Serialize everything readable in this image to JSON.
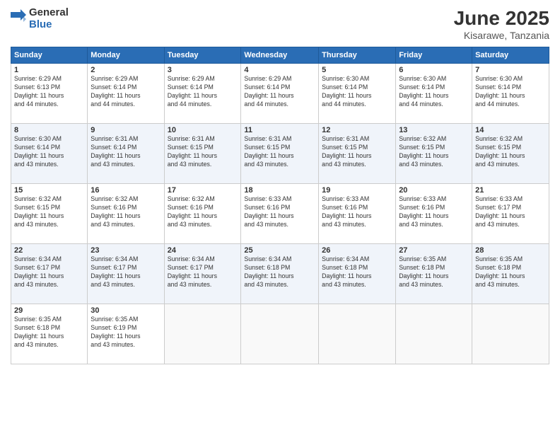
{
  "logo": {
    "general": "General",
    "blue": "Blue"
  },
  "title": {
    "month": "June 2025",
    "location": "Kisarawe, Tanzania"
  },
  "weekdays": [
    "Sunday",
    "Monday",
    "Tuesday",
    "Wednesday",
    "Thursday",
    "Friday",
    "Saturday"
  ],
  "weeks": [
    [
      {
        "day": "1",
        "info": "Sunrise: 6:29 AM\nSunset: 6:13 PM\nDaylight: 11 hours\nand 44 minutes."
      },
      {
        "day": "2",
        "info": "Sunrise: 6:29 AM\nSunset: 6:14 PM\nDaylight: 11 hours\nand 44 minutes."
      },
      {
        "day": "3",
        "info": "Sunrise: 6:29 AM\nSunset: 6:14 PM\nDaylight: 11 hours\nand 44 minutes."
      },
      {
        "day": "4",
        "info": "Sunrise: 6:29 AM\nSunset: 6:14 PM\nDaylight: 11 hours\nand 44 minutes."
      },
      {
        "day": "5",
        "info": "Sunrise: 6:30 AM\nSunset: 6:14 PM\nDaylight: 11 hours\nand 44 minutes."
      },
      {
        "day": "6",
        "info": "Sunrise: 6:30 AM\nSunset: 6:14 PM\nDaylight: 11 hours\nand 44 minutes."
      },
      {
        "day": "7",
        "info": "Sunrise: 6:30 AM\nSunset: 6:14 PM\nDaylight: 11 hours\nand 44 minutes."
      }
    ],
    [
      {
        "day": "8",
        "info": "Sunrise: 6:30 AM\nSunset: 6:14 PM\nDaylight: 11 hours\nand 43 minutes."
      },
      {
        "day": "9",
        "info": "Sunrise: 6:31 AM\nSunset: 6:14 PM\nDaylight: 11 hours\nand 43 minutes."
      },
      {
        "day": "10",
        "info": "Sunrise: 6:31 AM\nSunset: 6:15 PM\nDaylight: 11 hours\nand 43 minutes."
      },
      {
        "day": "11",
        "info": "Sunrise: 6:31 AM\nSunset: 6:15 PM\nDaylight: 11 hours\nand 43 minutes."
      },
      {
        "day": "12",
        "info": "Sunrise: 6:31 AM\nSunset: 6:15 PM\nDaylight: 11 hours\nand 43 minutes."
      },
      {
        "day": "13",
        "info": "Sunrise: 6:32 AM\nSunset: 6:15 PM\nDaylight: 11 hours\nand 43 minutes."
      },
      {
        "day": "14",
        "info": "Sunrise: 6:32 AM\nSunset: 6:15 PM\nDaylight: 11 hours\nand 43 minutes."
      }
    ],
    [
      {
        "day": "15",
        "info": "Sunrise: 6:32 AM\nSunset: 6:15 PM\nDaylight: 11 hours\nand 43 minutes."
      },
      {
        "day": "16",
        "info": "Sunrise: 6:32 AM\nSunset: 6:16 PM\nDaylight: 11 hours\nand 43 minutes."
      },
      {
        "day": "17",
        "info": "Sunrise: 6:32 AM\nSunset: 6:16 PM\nDaylight: 11 hours\nand 43 minutes."
      },
      {
        "day": "18",
        "info": "Sunrise: 6:33 AM\nSunset: 6:16 PM\nDaylight: 11 hours\nand 43 minutes."
      },
      {
        "day": "19",
        "info": "Sunrise: 6:33 AM\nSunset: 6:16 PM\nDaylight: 11 hours\nand 43 minutes."
      },
      {
        "day": "20",
        "info": "Sunrise: 6:33 AM\nSunset: 6:16 PM\nDaylight: 11 hours\nand 43 minutes."
      },
      {
        "day": "21",
        "info": "Sunrise: 6:33 AM\nSunset: 6:17 PM\nDaylight: 11 hours\nand 43 minutes."
      }
    ],
    [
      {
        "day": "22",
        "info": "Sunrise: 6:34 AM\nSunset: 6:17 PM\nDaylight: 11 hours\nand 43 minutes."
      },
      {
        "day": "23",
        "info": "Sunrise: 6:34 AM\nSunset: 6:17 PM\nDaylight: 11 hours\nand 43 minutes."
      },
      {
        "day": "24",
        "info": "Sunrise: 6:34 AM\nSunset: 6:17 PM\nDaylight: 11 hours\nand 43 minutes."
      },
      {
        "day": "25",
        "info": "Sunrise: 6:34 AM\nSunset: 6:18 PM\nDaylight: 11 hours\nand 43 minutes."
      },
      {
        "day": "26",
        "info": "Sunrise: 6:34 AM\nSunset: 6:18 PM\nDaylight: 11 hours\nand 43 minutes."
      },
      {
        "day": "27",
        "info": "Sunrise: 6:35 AM\nSunset: 6:18 PM\nDaylight: 11 hours\nand 43 minutes."
      },
      {
        "day": "28",
        "info": "Sunrise: 6:35 AM\nSunset: 6:18 PM\nDaylight: 11 hours\nand 43 minutes."
      }
    ],
    [
      {
        "day": "29",
        "info": "Sunrise: 6:35 AM\nSunset: 6:18 PM\nDaylight: 11 hours\nand 43 minutes."
      },
      {
        "day": "30",
        "info": "Sunrise: 6:35 AM\nSunset: 6:19 PM\nDaylight: 11 hours\nand 43 minutes."
      },
      {
        "day": "",
        "info": ""
      },
      {
        "day": "",
        "info": ""
      },
      {
        "day": "",
        "info": ""
      },
      {
        "day": "",
        "info": ""
      },
      {
        "day": "",
        "info": ""
      }
    ]
  ]
}
